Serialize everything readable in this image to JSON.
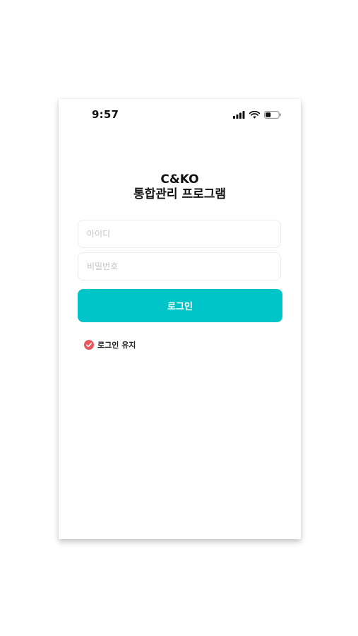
{
  "status_bar": {
    "time": "9:57",
    "icons": [
      "signal-icon",
      "wifi-icon",
      "battery-icon"
    ]
  },
  "header": {
    "title_line1": "C&KO",
    "title_line2": "통합관리 프로그램"
  },
  "form": {
    "id_placeholder": "아이디",
    "id_value": "",
    "password_placeholder": "비밀번호",
    "password_value": "",
    "login_label": "로그인",
    "keep_login_label": "로그인 유지",
    "keep_login_checked": true
  },
  "colors": {
    "accent": "#00c5c8",
    "check": "#e8565e"
  }
}
